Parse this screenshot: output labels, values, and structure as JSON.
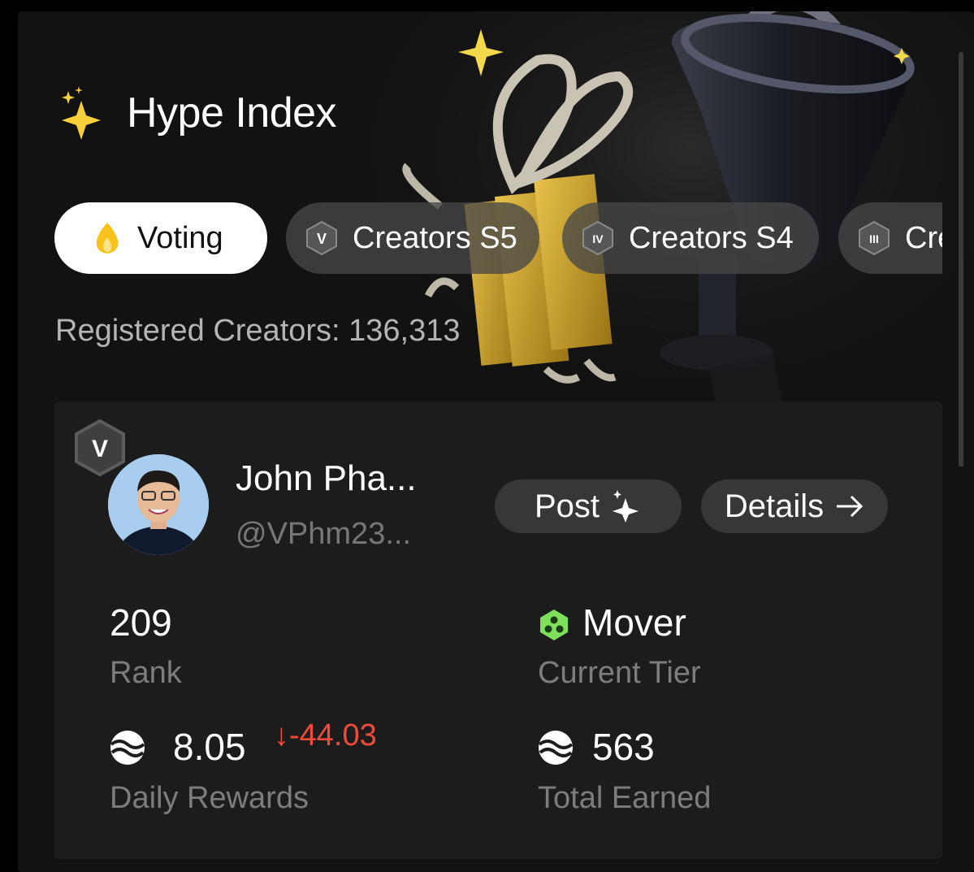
{
  "header": {
    "title": "Hype Index",
    "icon": "sparkles-icon",
    "icon_color": "#f5d03a"
  },
  "tabs": [
    {
      "label": "Voting",
      "icon": "flame-icon",
      "active": true
    },
    {
      "label": "Creators S5",
      "icon": "season-v-badge-icon",
      "badge": "V",
      "active": false
    },
    {
      "label": "Creators S4",
      "icon": "season-iv-badge-icon",
      "badge": "IV",
      "active": false
    },
    {
      "label": "Cre",
      "icon": "season-iii-badge-icon",
      "badge": "III",
      "active": false
    }
  ],
  "registered_text": "Registered Creators: 136,313",
  "profile": {
    "season_badge": "V",
    "name": "John Pha...",
    "handle": "@VPhm23...",
    "post_label": "Post",
    "details_label": "Details"
  },
  "stats": {
    "rank_value": "209",
    "rank_label": "Rank",
    "tier_value": "Mover",
    "tier_label": "Current Tier",
    "tier_color": "#7ee05a",
    "daily_value": "8.05",
    "daily_delta": "↓-44.03",
    "daily_delta_color": "#f04a3a",
    "daily_label": "Daily Rewards",
    "total_value": "563",
    "total_label": "Total Earned"
  }
}
